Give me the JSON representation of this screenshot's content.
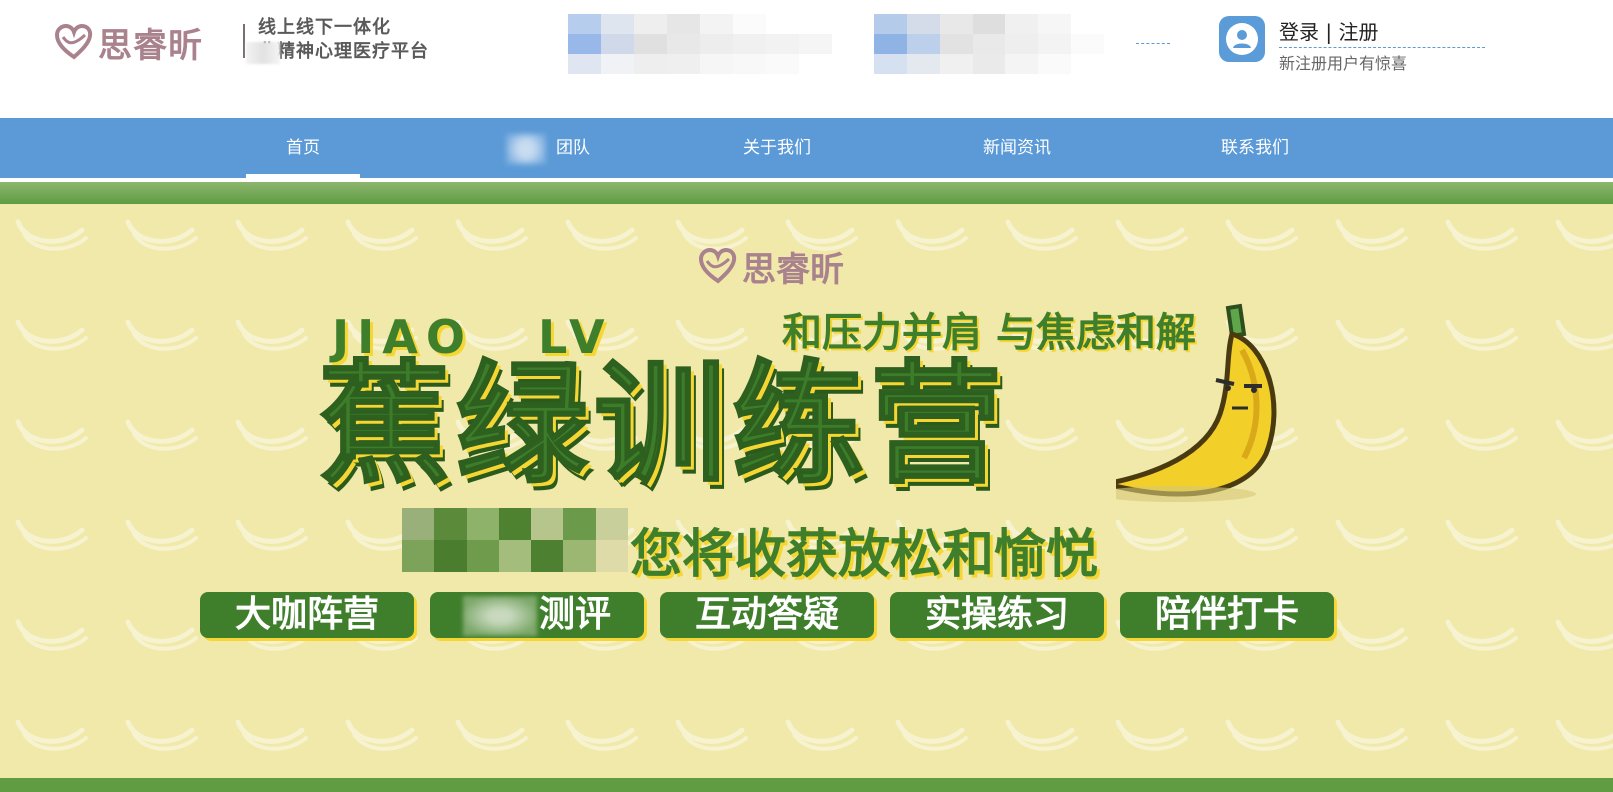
{
  "header": {
    "logo_text": "思睿昕",
    "slogan_line1": "线上线下一体化",
    "slogan_line2": "业精神心理医疗平台",
    "login_label": "登录",
    "separator": "|",
    "register_label": "注册",
    "login_subtext": "新注册用户有惊喜"
  },
  "nav": {
    "items": [
      {
        "label": "首页"
      },
      {
        "label": "团队"
      },
      {
        "label": "关于我们"
      },
      {
        "label": "新闻资讯"
      },
      {
        "label": "联系我们"
      }
    ]
  },
  "banner": {
    "logo_text": "思睿昕",
    "jiao": "JIAO",
    "lv": "LV",
    "tagline": "和压力并肩  与焦虑和解",
    "main_title": "蕉绿训练营",
    "subtitle": "您将收获放松和愉悦",
    "tags": [
      {
        "label": "大咖阵营"
      },
      {
        "label": "测评"
      },
      {
        "label": "互动答疑"
      },
      {
        "label": "实操练习"
      },
      {
        "label": "陪伴打卡"
      }
    ]
  },
  "colors": {
    "nav_blue": "#5b9ad7",
    "brand_pink": "#a9828d",
    "banner_yellow": "#f0e9a9",
    "banner_green": "#3f7f2c",
    "accent_yellow": "#f6d633"
  },
  "icons": [
    "heart-logo-icon",
    "user-avatar-icon",
    "banana-mascot-icon"
  ]
}
